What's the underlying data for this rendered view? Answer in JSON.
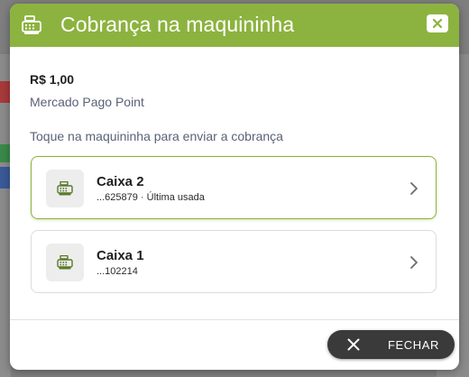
{
  "dialog": {
    "title": "Cobrança na maquininha",
    "header_icon": "cash-register-icon",
    "close_icon": "close-icon"
  },
  "payment": {
    "amount": "R$ 1,00",
    "provider": "Mercado Pago Point",
    "instruction": "Toque na maquininha para enviar a cobrança"
  },
  "terminals": [
    {
      "name": "Caixa 2",
      "detail": "...625879 · Última usada",
      "selected": true,
      "icon": "cash-register-icon"
    },
    {
      "name": "Caixa 1",
      "detail": "...102214",
      "selected": false,
      "icon": "cash-register-icon"
    }
  ],
  "footer": {
    "close_label": "FECHAR",
    "close_icon": "close-icon"
  },
  "colors": {
    "accent": "#8cb33f",
    "button_dark": "#3a3a3a",
    "icon_green": "#5a7a2a"
  }
}
